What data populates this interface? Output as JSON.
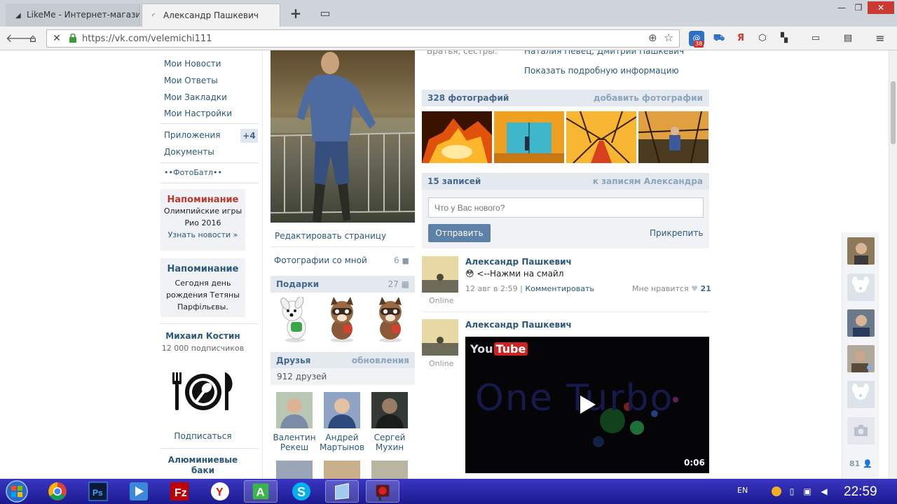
{
  "browser": {
    "tabs": [
      {
        "title": "LikeMe - Интернет-магазин Ch",
        "active": false
      },
      {
        "title": "Александр Пашкевич",
        "active": true
      }
    ],
    "new_tab": "+",
    "url": "https://vk.com/velemichi111",
    "extension_badge": "38",
    "icons": [
      "back-icon",
      "home-icon",
      "stop-icon",
      "lock-icon",
      "zoom-icon",
      "star-icon"
    ]
  },
  "left_menu": {
    "items": [
      "Мои Новости",
      "Мои Ответы",
      "Мои Закладки",
      "Мои Настройки",
      "Приложения",
      "Документы",
      "••ФотоБатл••"
    ],
    "apps_count": "+4",
    "reminder1": {
      "title": "Напоминание",
      "line1": "Олимпийские игры",
      "line2": "Рио 2016",
      "link": "Узнать новости »"
    },
    "reminder2": {
      "title": "Напоминание",
      "line1": "Сегодня день",
      "line2": "рождения Тетяны",
      "line3": "Парфільєвы."
    },
    "public": {
      "name": "Михаил Костин",
      "subs": "12 000 подписчиков",
      "subscribe": "Подписаться",
      "next_name_1": "Алюминиевые",
      "next_name_2": "баки"
    }
  },
  "profile": {
    "edit_page": "Редактировать страницу",
    "photos_with_me": "Фотографии со мной",
    "photos_with_me_count": "6",
    "gifts_title": "Подарки",
    "gifts_count": "27",
    "friends_title": "Друзья",
    "friends_updates": "обновления",
    "friends_count": "912 друзей",
    "friends": [
      {
        "first": "Валентин",
        "last": "Рекеш"
      },
      {
        "first": "Андрей",
        "last": "Мартынов"
      },
      {
        "first": "Сергей",
        "last": "Мухин"
      }
    ]
  },
  "wall": {
    "relatives_label": "Братья, сестры:",
    "relatives_value": "Наталия Певец, Дмитрий Пашкевич",
    "more_info": "Показать подробную информацию",
    "photos_title": "328 фотографий",
    "photos_add": "добавить фотографии",
    "posts_title": "15 записей",
    "posts_link": "к записям Александра",
    "post_placeholder": "Что у Вас нового?",
    "send": "Отправить",
    "attach": "Прикрепить",
    "post1": {
      "author": "Александр Пашкевич",
      "text": "<--Нажми на смайл",
      "date": "12 авг в 2:59",
      "comment": "Комментировать",
      "like_label": "Мне нравится",
      "likes": "21",
      "status": "Online"
    },
    "post2": {
      "author": "Александр Пашкевич",
      "status": "Online",
      "video_logo": "You",
      "video_logo_tube": "Tube",
      "video_title": "One Turbo",
      "duration": "0:06"
    }
  },
  "right_sidebar": {
    "online_count": "81"
  },
  "taskbar": {
    "lang": "EN",
    "time": "22:59"
  },
  "colors": {
    "vk_link": "#2b587a",
    "vk_header_bg": "#e4e9ef",
    "vk_button": "#5e81a8",
    "taskbar": "#2a27a8"
  }
}
